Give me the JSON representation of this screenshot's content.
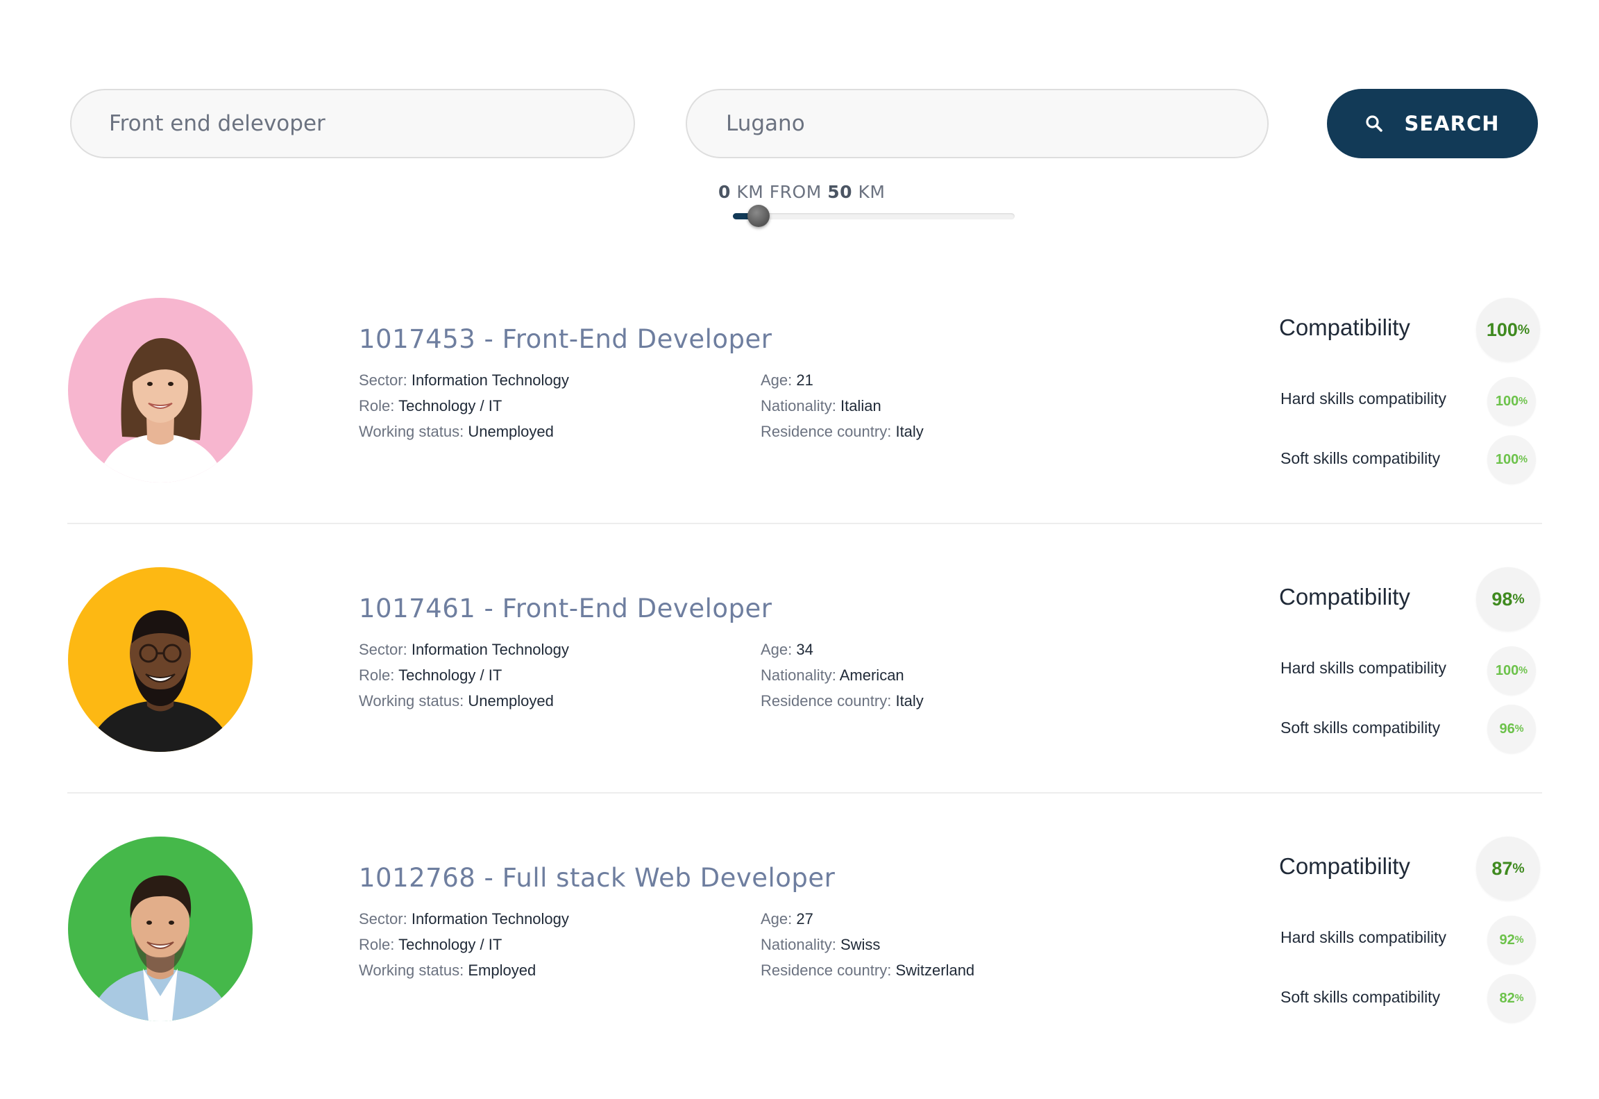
{
  "search": {
    "keyword_value": "Front end delevoper",
    "location_value": "Lugano",
    "button_label": "SEARCH",
    "range": {
      "min_value": "0",
      "unit": "KM",
      "from_word": "FROM",
      "max_value": "50",
      "slider_level": 0.09
    }
  },
  "labels": {
    "sector": "Sector:",
    "role": "Role:",
    "working_status": "Working status:",
    "age": "Age:",
    "nationality": "Nationality:",
    "residence": "Residence country:",
    "compatibility": "Compatibility",
    "hard_skills": "Hard skills compatibility",
    "soft_skills": "Soft skills compatibility",
    "percent_sign": "%"
  },
  "colors": {
    "accent": "#123a57",
    "title": "#6e7e9f",
    "compat_main": "#3f8a1f",
    "compat_sub": "#6cc24a"
  },
  "candidates": [
    {
      "title": "1017453 - Front-End Developer",
      "sector": "Information Technology",
      "role": "Technology / IT",
      "working_status": "Unemployed",
      "age": "21",
      "nationality": "Italian",
      "residence": "Italy",
      "compatibility": "100",
      "hard_skills": "100",
      "soft_skills": "100",
      "avatar_bg": "#f7b6cf"
    },
    {
      "title": "1017461 - Front-End Developer",
      "sector": "Information Technology",
      "role": "Technology / IT",
      "working_status": "Unemployed",
      "age": "34",
      "nationality": "American",
      "residence": "Italy",
      "compatibility": "98",
      "hard_skills": "100",
      "soft_skills": "96",
      "avatar_bg": "#fdb813"
    },
    {
      "title": "1012768 - Full stack Web Developer",
      "sector": "Information Technology",
      "role": "Technology / IT",
      "working_status": "Employed",
      "age": "27",
      "nationality": "Swiss",
      "residence": "Switzerland",
      "compatibility": "87",
      "hard_skills": "92",
      "soft_skills": "82",
      "avatar_bg": "#45b84a"
    }
  ]
}
